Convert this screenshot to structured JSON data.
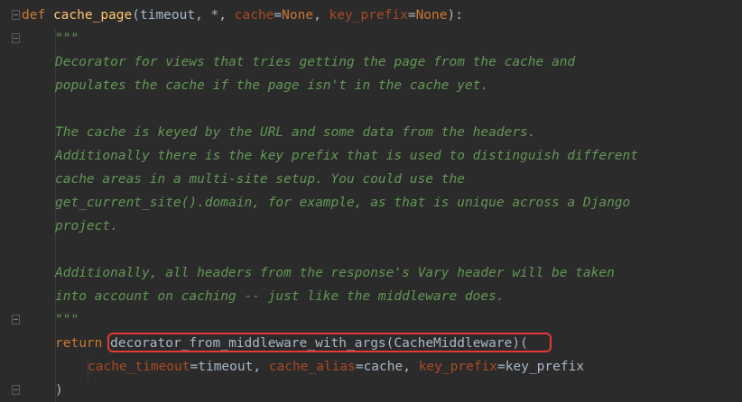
{
  "code": {
    "def_line": {
      "kw_def": "def",
      "func_name": "cache_page",
      "open": "(timeout, *, ",
      "param_cache": "cache",
      "eq1": "=",
      "none1": "None",
      "sep": ", ",
      "param_key_prefix": "key_prefix",
      "eq2": "=",
      "none2": "None",
      "close": "):"
    },
    "doc_open": "\"\"\"",
    "doc_lines": [
      "Decorator for views that tries getting the page from the cache and",
      "populates the cache if the page isn't in the cache yet.",
      "",
      "The cache is keyed by the URL and some data from the headers.",
      "Additionally there is the key prefix that is used to distinguish different",
      "cache areas in a multi-site setup. You could use the",
      "get_current_site().domain, for example, as that is unique across a Django",
      "project.",
      "",
      "Additionally, all headers from the response's Vary header will be taken",
      "into account on caching -- just like the middleware does."
    ],
    "doc_close": "\"\"\"",
    "return_line": {
      "kw_return": "return",
      "call": "decorator_from_middleware_with_args(CacheMiddleware)("
    },
    "args_line": {
      "arg1_name": "cache_timeout",
      "arg1_eq": "=",
      "arg1_val": "timeout",
      "sep1": ", ",
      "arg2_name": "cache_alias",
      "arg2_eq": "=",
      "arg2_val": "cache",
      "sep2": ", ",
      "arg3_name": "key_prefix",
      "arg3_eq": "=",
      "arg3_val": "key_prefix"
    },
    "close_paren": ")"
  },
  "colors": {
    "background": "#2b2b2b",
    "keyword": "#cc7832",
    "function": "#ffc66d",
    "docstring": "#629755",
    "param": "#aa4926",
    "default_text": "#a9b7c6",
    "highlight": "#e53935"
  }
}
